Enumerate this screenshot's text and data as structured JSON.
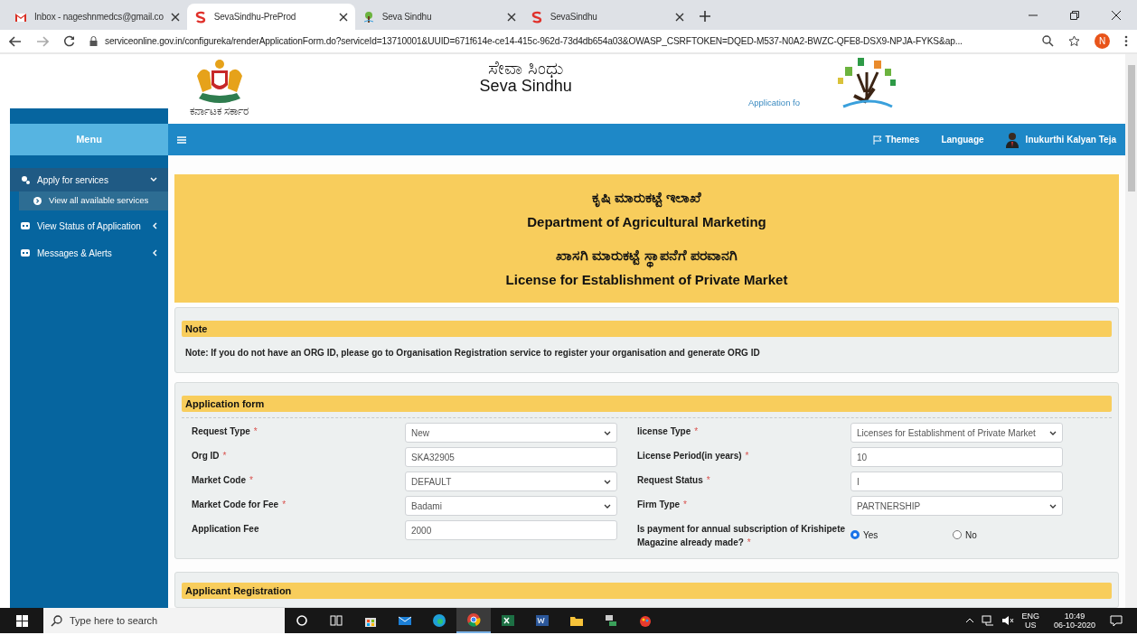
{
  "browser": {
    "tabs": [
      {
        "kind": "mail",
        "title": "Inbox - nageshnmedcs@gmail.co",
        "selected": false
      },
      {
        "kind": "brand",
        "title": "SevaSindhu-PreProd",
        "selected": true
      },
      {
        "kind": "tree",
        "title": "Seva Sindhu",
        "selected": false
      },
      {
        "kind": "brand",
        "title": "SevaSindhu",
        "selected": false
      }
    ],
    "url": "serviceonline.gov.in/configureka/renderApplicationForm.do?serviceId=13710001&UUID=671f614e-ce14-415c-962d-73d4db654a03&OWASP_CSRFTOKEN=DQED-M537-N0A2-BWZC-QFE8-DSX9-NPJA-FYKS&ap...",
    "profile_initial": "N"
  },
  "header": {
    "emblem_caption": "ಕರ್ನಾಟಕ ಸರ್ಕಾರ",
    "title_kannada": "ಸೇವಾ ಸಿಂಧು",
    "title": "Seva Sindhu",
    "tagline": "Application fo"
  },
  "sidebar": {
    "heading": "Menu",
    "items": [
      {
        "label": "Apply for services",
        "expanded": true,
        "selected": true,
        "children": [
          {
            "label": "View all available services",
            "selected": true
          }
        ]
      },
      {
        "label": "View Status of Application",
        "expanded": false,
        "selected": false
      },
      {
        "label": "Messages & Alerts",
        "expanded": false,
        "selected": false
      }
    ]
  },
  "navbar": {
    "themes": "Themes",
    "language": "Language",
    "user": "Inukurthi Kalyan Teja"
  },
  "banner": [
    "ಕೃಷಿ ಮಾರುಕಟ್ಟೆ ಇಲಾಖೆ",
    "Department of Agricultural Marketing",
    "ಖಾಸಗಿ ಮಾರುಕಟ್ಟೆ ಸ್ಥಾಪನೆಗೆ ಪರವಾನಗಿ",
    "License for Establishment of Private Market"
  ],
  "note": {
    "heading": "Note",
    "text": "Note: If you do not have an ORG ID, please go to Organisation Registration service to register your organisation and generate ORG ID"
  },
  "application_form": {
    "heading": "Application form",
    "fields": [
      {
        "label": "Request Type",
        "asterisk": "*",
        "kind": "select",
        "value": "New"
      },
      {
        "label": "license Type",
        "asterisk": "*",
        "kind": "select",
        "value": "Licenses for Establishment of Private Market"
      },
      {
        "label": "Org ID",
        "asterisk": "*",
        "kind": "text",
        "value": "SKA32905"
      },
      {
        "label": "License Period(in years)",
        "asterisk": "*",
        "kind": "text",
        "value": "10"
      },
      {
        "label": "Market Code",
        "asterisk": "*",
        "kind": "select",
        "value": "DEFAULT"
      },
      {
        "label": "Request Status",
        "asterisk": "*",
        "kind": "text",
        "value": "I"
      },
      {
        "label": "Market Code for Fee",
        "asterisk": "*",
        "kind": "select",
        "value": "Badami"
      },
      {
        "label": "Firm Type",
        "asterisk": "*",
        "kind": "select",
        "value": "PARTNERSHIP"
      },
      {
        "label": "Application Fee",
        "kind": "text",
        "value": "2000"
      },
      {
        "label": "Is payment for annual subscription of Krishipete Magazine already made?",
        "asterisk": "*",
        "kind": "radio",
        "options": [
          {
            "label": "Yes",
            "selected": true
          },
          {
            "label": "No",
            "selected": false
          }
        ]
      }
    ]
  },
  "next_section": {
    "heading": "Applicant Registration"
  },
  "taskbar": {
    "search_placeholder": "Type here to search",
    "apps": [
      {
        "kind": "cortana",
        "active": false
      },
      {
        "kind": "taskview",
        "active": false
      },
      {
        "kind": "store",
        "active": false
      },
      {
        "kind": "mail",
        "active": false
      },
      {
        "kind": "edge",
        "active": false
      },
      {
        "kind": "chrome",
        "active": true
      },
      {
        "kind": "excel",
        "active": false
      },
      {
        "kind": "word",
        "active": false
      },
      {
        "kind": "explorer",
        "active": false
      },
      {
        "kind": "network",
        "active": false
      },
      {
        "kind": "paint",
        "active": false
      }
    ],
    "language": "ENG",
    "region": "US",
    "time": "10:49",
    "date": "06-10-2020"
  }
}
